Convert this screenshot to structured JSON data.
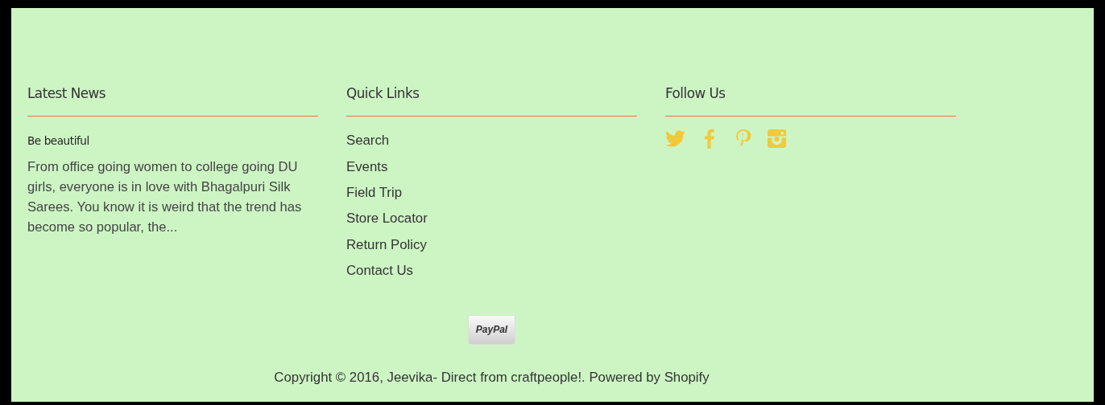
{
  "columns": [
    {
      "kind": "news",
      "heading": "Latest News",
      "article_title": "Be beautiful",
      "excerpt": "From office going women to college going DU girls, everyone is in love with Bhagalpuri Silk Sarees. You know it is weird that the trend has become so popular, the..."
    },
    {
      "kind": "links",
      "heading": "Quick Links",
      "links": [
        "Search",
        "Events",
        "Field Trip",
        "Store Locator",
        "Return Policy",
        "Contact Us"
      ]
    },
    {
      "kind": "social",
      "heading": "Follow Us",
      "icons": [
        {
          "kind": "bird"
        },
        {
          "kind": "f"
        },
        {
          "kind": "p"
        },
        {
          "kind": "camera"
        }
      ]
    }
  ],
  "payment": {
    "label": "PayPal"
  },
  "copyright": "Copyright © 2016, Jeevika- Direct from craftpeople!. Powered by Shopify"
}
